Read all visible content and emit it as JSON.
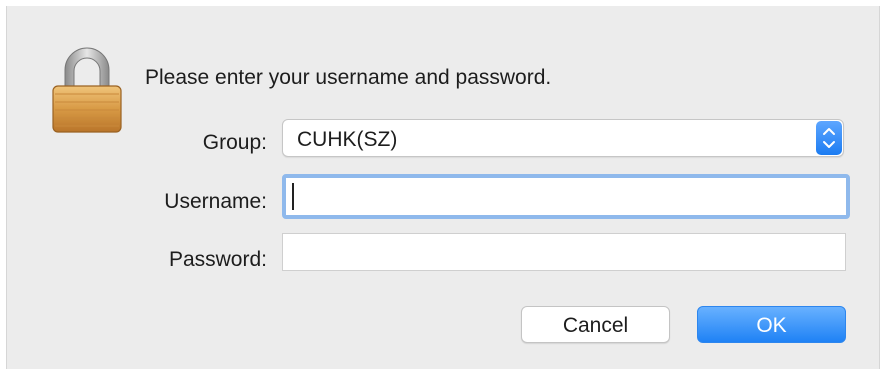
{
  "dialog": {
    "prompt": "Please enter your username and password.",
    "icon": "lock-icon"
  },
  "form": {
    "group_label": "Group:",
    "group_value": "CUHK(SZ)",
    "username_label": "Username:",
    "username_value": "",
    "password_label": "Password:",
    "password_value": ""
  },
  "buttons": {
    "cancel_label": "Cancel",
    "ok_label": "OK"
  },
  "colors": {
    "accent": "#1f82f5",
    "focus_ring": "#8fb9ec",
    "dialog_background": "#ececec"
  }
}
